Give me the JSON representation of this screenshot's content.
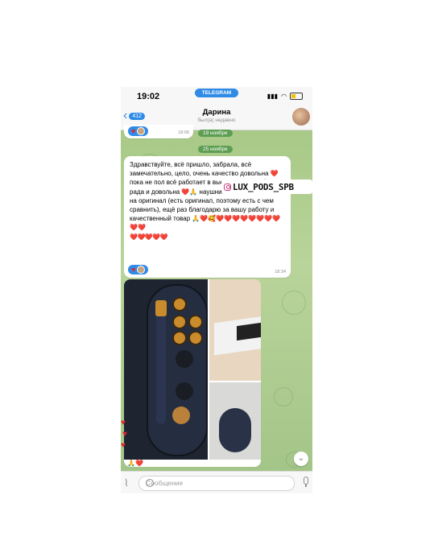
{
  "status_bar": {
    "time": "19:02",
    "telegram_label": "TELEGRAM",
    "icons": [
      "location-arrow-icon",
      "signal-icon",
      "wifi-icon",
      "battery-icon"
    ],
    "battery_color": "#f2c200"
  },
  "header": {
    "back_badge": "412",
    "contact_name": "Дарина",
    "contact_status": "был(а) недавно"
  },
  "messages": {
    "first": {
      "reaction_emoji": "❤️",
      "time": "18:06"
    },
    "dates": [
      "19 ноября",
      "25 ноября"
    ],
    "main": {
      "text": "Здравствуйте, всё пришло, забрала, всё замечательно, цело, очень качество довольна ❤️ пока не пол         всё работает в высшем классе, безумно рада и довольна ❤️🙏 наушники тоже очень похожи на оригинал (есть оригинал, поэтому есть с чем сравнить), ещё раз благодарю за вашу работу и качественный товар 🙏❤️🥰❤️❤️❤️❤️❤️❤️❤️❤️❤️❤️",
      "hearts_tail": "❤️❤️❤️❤️❤️",
      "reaction_emoji": "❤️",
      "time": "18:34"
    },
    "photo_reaction": "🙏❤️"
  },
  "watermark": {
    "text": "LUX_PODS_SPB"
  },
  "composer": {
    "placeholder": "Сообщение"
  },
  "colors": {
    "accent": "#2f8be6",
    "chat_background": "#a8c987",
    "date_pill": "#5e9e52",
    "heart": "#e5252a",
    "product_gold": "#c98b2c",
    "product_navy": "#252d40"
  }
}
